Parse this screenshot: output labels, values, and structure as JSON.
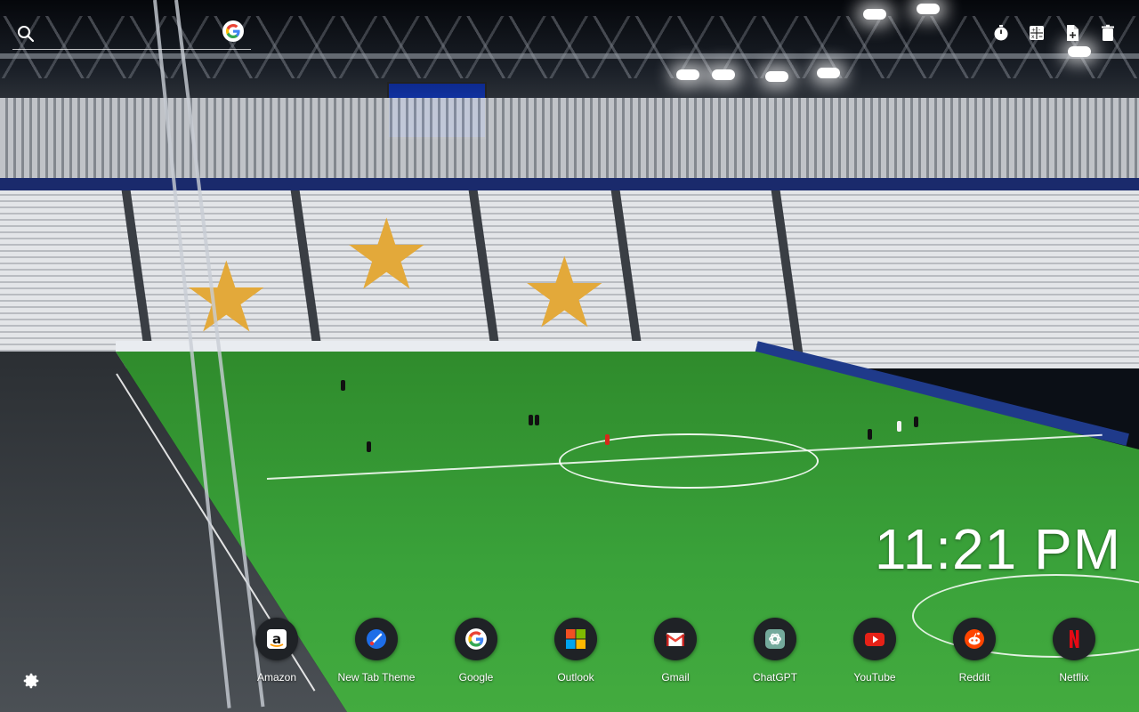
{
  "search": {
    "placeholder": "",
    "value": ""
  },
  "top_tools": [
    {
      "name": "timer-icon"
    },
    {
      "name": "calculator-icon"
    },
    {
      "name": "notes-icon"
    },
    {
      "name": "trash-icon"
    }
  ],
  "clock": {
    "time": "11:21 PM"
  },
  "apps": [
    {
      "label": "Amazon",
      "icon": "amazon-icon"
    },
    {
      "label": "New Tab Theme",
      "icon": "new-tab-theme-icon"
    },
    {
      "label": "Google",
      "icon": "google-icon"
    },
    {
      "label": "Outlook",
      "icon": "outlook-icon"
    },
    {
      "label": "Gmail",
      "icon": "gmail-icon"
    },
    {
      "label": "ChatGPT",
      "icon": "chatgpt-icon"
    },
    {
      "label": "YouTube",
      "icon": "youtube-icon"
    },
    {
      "label": "Reddit",
      "icon": "reddit-icon"
    },
    {
      "label": "Netflix",
      "icon": "netflix-icon"
    }
  ],
  "colors": {
    "dock_circle": "#1f2226",
    "youtube": "#e62117",
    "reddit": "#ff4500",
    "netflix": "#e50914",
    "star": "#e3a93a",
    "pitch": "#3aa23a"
  }
}
